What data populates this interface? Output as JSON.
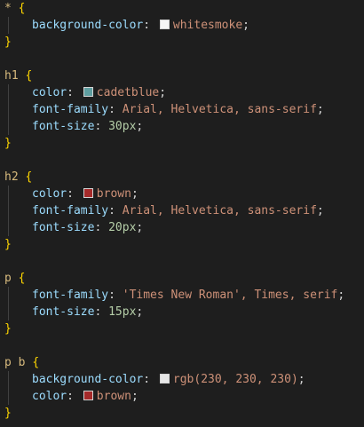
{
  "colors": {
    "whitesmoke": "#f5f5f5",
    "cadetblue": "#5f9ea0",
    "brown": "#a52a2a",
    "rgb230": "#e6e6e6"
  },
  "rules": [
    {
      "selector": "*",
      "decls": [
        {
          "prop": "background-color",
          "value": "whitesmoke"
        }
      ]
    },
    {
      "selector": "h1",
      "decls": [
        {
          "prop": "color",
          "value": "cadetblue"
        },
        {
          "prop": "font-family",
          "value": "Arial, Helvetica, sans-serif"
        },
        {
          "prop": "font-size",
          "value": "30px"
        }
      ]
    },
    {
      "selector": "h2",
      "decls": [
        {
          "prop": "color",
          "value": "brown"
        },
        {
          "prop": "font-family",
          "value": "Arial, Helvetica, sans-serif"
        },
        {
          "prop": "font-size",
          "value": "20px"
        }
      ]
    },
    {
      "selector": "p",
      "decls": [
        {
          "prop": "font-family",
          "value": "'Times New Roman', Times, serif"
        },
        {
          "prop": "font-size",
          "value": "15px"
        }
      ]
    },
    {
      "selector": "p b",
      "decls": [
        {
          "prop": "background-color",
          "value": "rgb(230, 230, 230)"
        },
        {
          "prop": "color",
          "value": "brown"
        }
      ]
    }
  ],
  "tokens": {
    "open_brace": "{",
    "close_brace": "}",
    "colon": ":",
    "semicolon": ";",
    "comma": ",",
    "paren_open": "(",
    "paren_close": ")"
  }
}
